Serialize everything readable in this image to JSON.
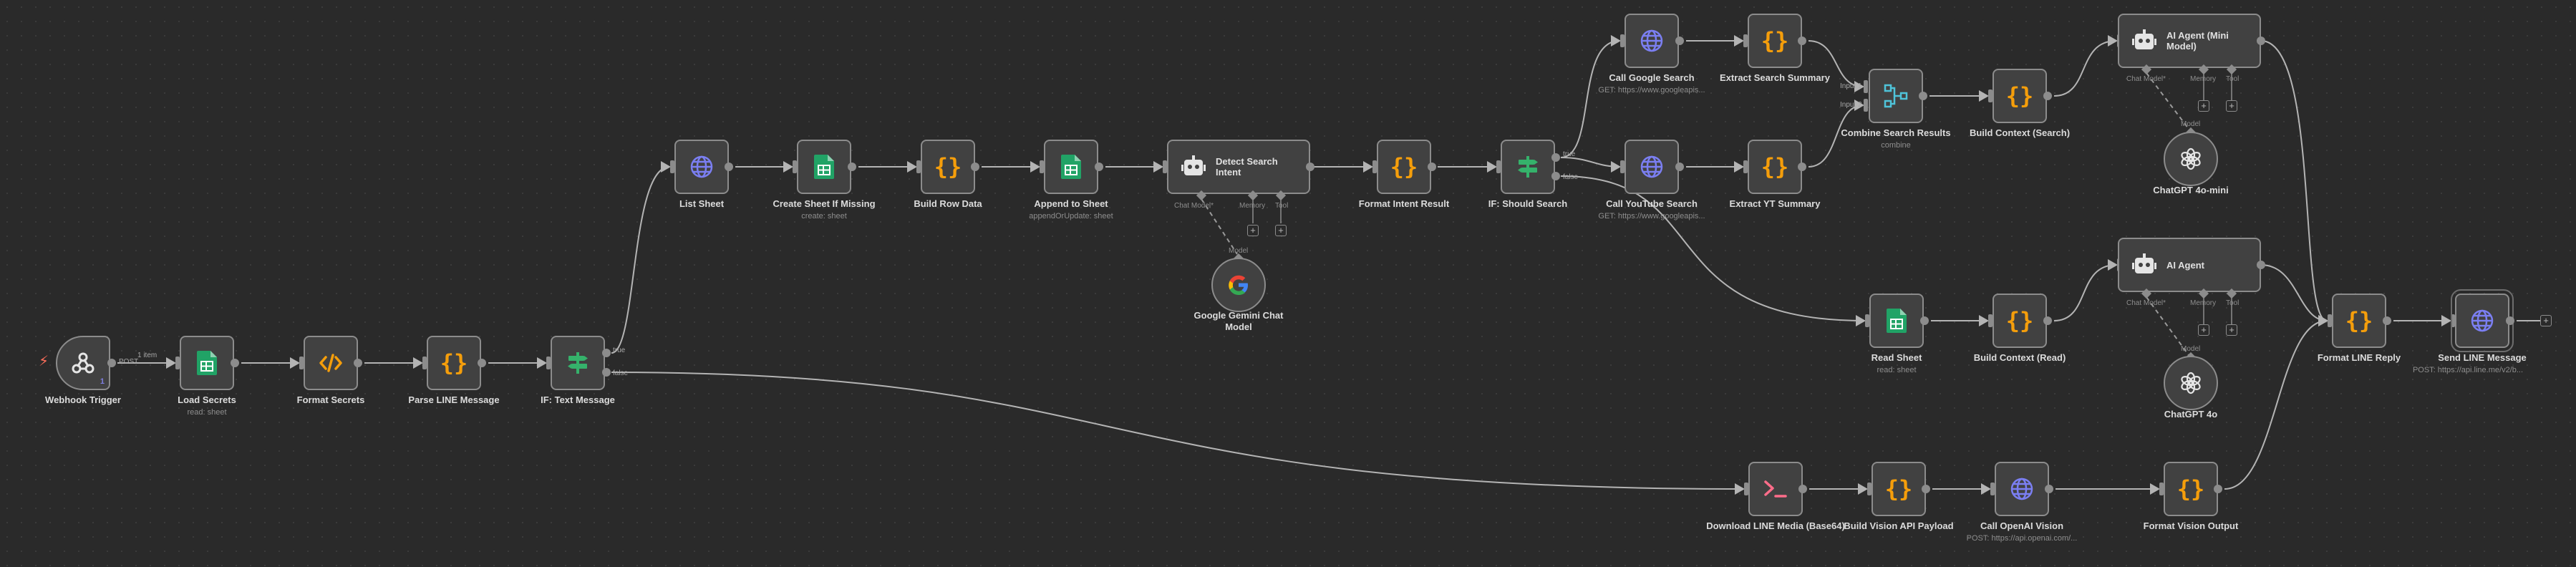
{
  "colors": {
    "background": "#2a2a2a",
    "node_fill": "#414141",
    "node_border": "#8c8c8c",
    "wire": "#b4b4b4",
    "sheets_green": "#21a366",
    "code_orange": "#f59e0b",
    "http_purple": "#7b7ff2",
    "if_green": "#35b26b",
    "trigger_orange": "#ff6d5a"
  },
  "nodes": {
    "webhook": {
      "title": "Webhook Trigger",
      "icon": "webhook-icon",
      "count": "1"
    },
    "load_secrets": {
      "title": "Load Secrets",
      "sub": "read: sheet",
      "icon": "google-sheets-icon"
    },
    "format_secrets": {
      "title": "Format Secrets",
      "icon": "code-icon"
    },
    "parse_line": {
      "title": "Parse LINE Message",
      "icon": "braces-icon"
    },
    "if_text": {
      "title": "IF: Text Message",
      "icon": "if-icon"
    },
    "list_sheet": {
      "title": "List Sheet",
      "icon": "globe-icon"
    },
    "create_sheet": {
      "title": "Create Sheet If Missing",
      "sub": "create: sheet",
      "icon": "google-sheets-icon"
    },
    "build_row": {
      "title": "Build Row Data",
      "icon": "braces-icon"
    },
    "append_sheet": {
      "title": "Append to Sheet",
      "sub": "appendOrUpdate: sheet",
      "icon": "google-sheets-icon"
    },
    "detect_intent": {
      "title": "Detect Search Intent",
      "icon": "robot-icon"
    },
    "format_intent": {
      "title": "Format Intent Result",
      "icon": "braces-icon"
    },
    "if_search": {
      "title": "IF: Should Search",
      "icon": "if-icon"
    },
    "call_google": {
      "title": "Call Google Search",
      "sub": "GET: https://www.googleapis...",
      "icon": "globe-icon"
    },
    "extract_summary": {
      "title": "Extract Search Summary",
      "icon": "braces-icon"
    },
    "call_youtube": {
      "title": "Call YouTube Search",
      "sub": "GET: https://www.googleapis...",
      "icon": "globe-icon"
    },
    "extract_yt": {
      "title": "Extract YT Summary",
      "icon": "braces-icon"
    },
    "combine": {
      "title": "Combine Search Results",
      "sub": "combine",
      "icon": "merge-icon"
    },
    "build_ctx_search": {
      "title": "Build Context (Search)",
      "icon": "braces-icon"
    },
    "agent_mini": {
      "title": "AI Agent (Mini Model)",
      "icon": "robot-icon"
    },
    "gpt4o_mini": {
      "title": "ChatGPT 4o-mini",
      "icon": "openai-icon"
    },
    "read_sheet": {
      "title": "Read Sheet",
      "sub": "read: sheet",
      "icon": "google-sheets-icon"
    },
    "build_ctx_read": {
      "title": "Build Context (Read)",
      "icon": "braces-icon"
    },
    "agent": {
      "title": "AI Agent",
      "icon": "robot-icon"
    },
    "gpt4o": {
      "title": "ChatGPT 4o",
      "icon": "openai-icon"
    },
    "format_reply": {
      "title": "Format LINE Reply",
      "icon": "braces-icon"
    },
    "send_line": {
      "title": "Send LINE Message",
      "sub": "POST: https://api.line.me/v2/b...",
      "icon": "globe-icon"
    },
    "gemini": {
      "title": "Google Gemini Chat Model",
      "icon": "google-icon"
    },
    "download_media": {
      "title": "Download LINE Media (Base64)",
      "icon": "terminal-icon"
    },
    "build_vision": {
      "title": "Build Vision API Payload",
      "icon": "braces-icon"
    },
    "call_openai": {
      "title": "Call OpenAI Vision",
      "sub": "POST: https://api.openai.com/...",
      "icon": "globe-icon"
    },
    "format_vision": {
      "title": "Format Vision Output",
      "icon": "braces-icon"
    }
  },
  "edge_labels": {
    "webhook_items": "1 item",
    "webhook_method": "POST",
    "if_text_true": "true",
    "if_text_false": "false",
    "if_search_true": "true",
    "if_search_false": "false",
    "combine_in1": "Input 1",
    "combine_in2": "Input 2"
  },
  "agent_ports": {
    "chat_model": "Chat Model*",
    "memory": "Memory",
    "tool": "Tool",
    "model": "Model"
  }
}
